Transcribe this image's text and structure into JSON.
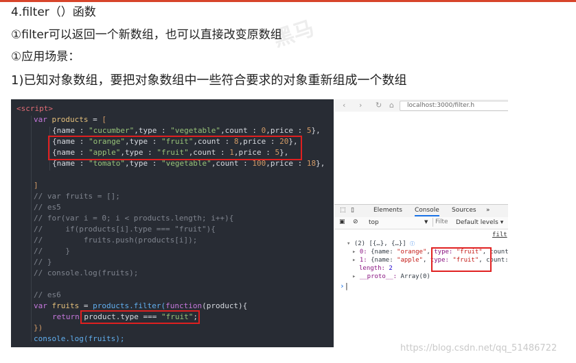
{
  "doc": {
    "heading": "4.filter（）函数",
    "line1": "①filter可以返回一个新数组，也可以直接改变原数组",
    "line2": "①应用场景：",
    "line3": "1)已知对象数组，要把对象数组中一些符合要求的对象重新组成一个数组"
  },
  "code": {
    "script_tag": "<script>",
    "var_kw": "var",
    "products_name": "products",
    "assign": " = ",
    "open_bracket": "[",
    "rows": [
      {
        "name": "\"cucumber\"",
        "type": "\"vegetable\"",
        "count": "0",
        "price": "5"
      },
      {
        "name": "\"orange\"",
        "type": "\"fruit\"",
        "count": "8",
        "price": "20"
      },
      {
        "name": "\"apple\"",
        "type": "\"fruit\"",
        "count": "1",
        "price": "5"
      },
      {
        "name": "\"tomato\"",
        "type": "\"vegetable\"",
        "count": "100",
        "price": "18"
      }
    ],
    "close_bracket": "]",
    "comments": [
      "// var fruits = [];",
      "// es5",
      "// for(var i = 0; i < products.length; i++){",
      "//     if(products[i].type === \"fruit\"){",
      "//         fruits.push(products[i]);",
      "//     }",
      "// }",
      "// console.log(fruits);"
    ],
    "es6_comment": "// es6",
    "fruits_name": "fruits",
    "filter_call": "products.filter(",
    "function_kw": "function",
    "param": "(product){",
    "return_kw": "return",
    "return_expr_obj": "product.type",
    "return_op": " === ",
    "return_str": "\"fruit\"",
    "return_semi": ";",
    "close_fn": "})",
    "console_log": "console.log(fruits);"
  },
  "devtools": {
    "url": "localhost:3000/filter.h",
    "tabs": [
      "Elements",
      "Console",
      "Sources",
      "»"
    ],
    "context": "top",
    "filter_placeholder": "Filte",
    "levels": "Default levels ▾",
    "filter_partial": "filt",
    "result_header": "(2) [{…}, {…}]",
    "item0_index": "0:",
    "item0_name": "\"orange\"",
    "item0_type": "\"fruit\"",
    "item0_tail": "count",
    "item1_index": "1:",
    "item1_name": "\"apple\"",
    "item1_type": "\"fruit\"",
    "item1_tail": "count:",
    "length_key": "length:",
    "length_val": "2",
    "proto_key": "__proto__:",
    "proto_val": "Array(0)",
    "prompt": "›"
  },
  "watermark": "https://blog.csdn.net/qq_51486722",
  "colors": {
    "highlight": "#e02020",
    "editor_bg": "#282c34"
  }
}
